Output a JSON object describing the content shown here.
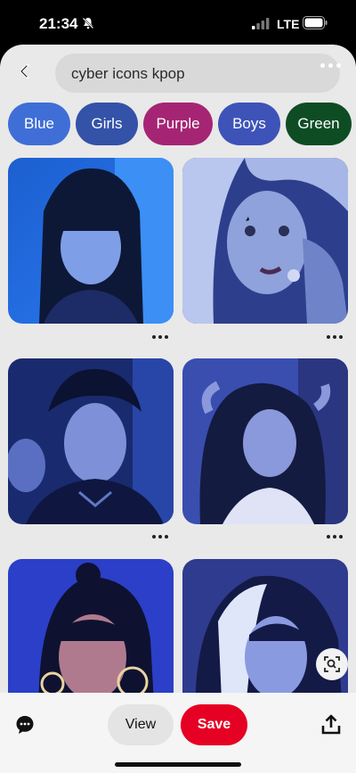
{
  "status_bar": {
    "time": "21:34",
    "network": "LTE"
  },
  "search": {
    "query": "cyber icons kpop"
  },
  "chips": [
    {
      "label": "Blue",
      "color": "#3f6fd6"
    },
    {
      "label": "Girls",
      "color": "#3452a8"
    },
    {
      "label": "Purple",
      "color": "#a52574"
    },
    {
      "label": "Boys",
      "color": "#3d53b8"
    },
    {
      "label": "Green",
      "color": "#0e4d24"
    }
  ],
  "pins": [
    {
      "subject": "portrait-blue-bangs"
    },
    {
      "subject": "portrait-blonde-star"
    },
    {
      "subject": "portrait-jacket"
    },
    {
      "subject": "portrait-hair-hands"
    },
    {
      "subject": "portrait-hoop-earrings"
    },
    {
      "subject": "portrait-white-streak"
    }
  ],
  "actions": {
    "view_label": "View",
    "save_label": "Save"
  },
  "colors": {
    "accent": "#e60023",
    "sheet": "#e9e9e9"
  }
}
